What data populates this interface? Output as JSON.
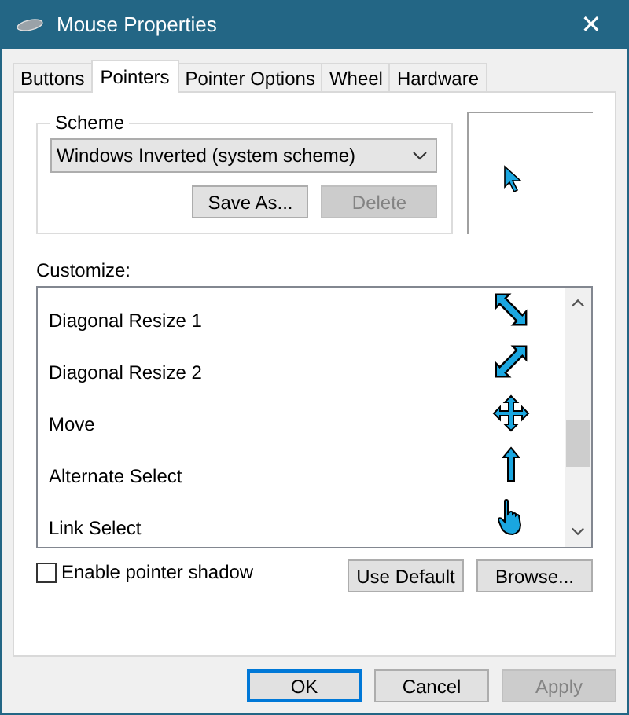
{
  "window": {
    "title": "Mouse Properties",
    "close": "✕"
  },
  "tabs": [
    {
      "label": "Buttons",
      "selected": false
    },
    {
      "label": "Pointers",
      "selected": true
    },
    {
      "label": "Pointer Options",
      "selected": false
    },
    {
      "label": "Wheel",
      "selected": false
    },
    {
      "label": "Hardware",
      "selected": false
    }
  ],
  "scheme": {
    "label": "Scheme",
    "value": "Windows Inverted (system scheme)",
    "buttons": [
      {
        "label": "Save As...",
        "disabled": false
      },
      {
        "label": "Delete",
        "disabled": true
      }
    ]
  },
  "customize": {
    "label": "Customize:",
    "rows": [
      {
        "name": "Diagonal Resize 1",
        "kind": "diagonal-down"
      },
      {
        "name": "Diagonal Resize 2",
        "kind": "diagonal-up"
      },
      {
        "name": "Move",
        "kind": "move"
      },
      {
        "name": "Alternate Select",
        "kind": "up-arrow"
      },
      {
        "name": "Link Select",
        "kind": "hand"
      }
    ]
  },
  "shadow": {
    "label": "Enable pointer shadow",
    "checked": false
  },
  "list_buttons": [
    {
      "label": "Use Default",
      "disabled": false
    },
    {
      "label": "Browse...",
      "disabled": false
    }
  ],
  "dialog_buttons": [
    {
      "label": "OK",
      "disabled": false,
      "focused": true
    },
    {
      "label": "Cancel",
      "disabled": false,
      "focused": false
    },
    {
      "label": "Apply",
      "disabled": true,
      "focused": false
    }
  ]
}
